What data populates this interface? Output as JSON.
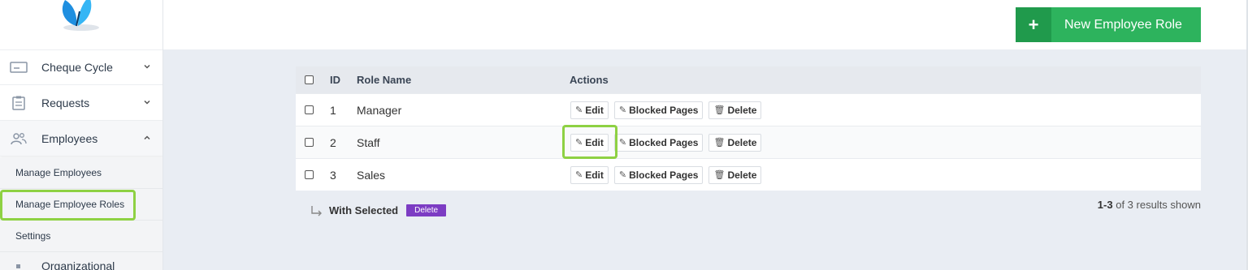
{
  "sidebar": {
    "items": [
      {
        "label": "Cheque Cycle",
        "icon": "card-icon",
        "expanded": false
      },
      {
        "label": "Requests",
        "icon": "clipboard-icon",
        "expanded": false
      },
      {
        "label": "Employees",
        "icon": "users-icon",
        "expanded": true
      }
    ],
    "subitems": [
      {
        "label": "Manage Employees"
      },
      {
        "label": "Manage Employee Roles",
        "highlighted": true
      },
      {
        "label": "Settings"
      }
    ],
    "partial_item": {
      "label": "Organizational"
    }
  },
  "header": {
    "new_button": {
      "label": "New Employee Role",
      "icon": "plus-icon"
    }
  },
  "table": {
    "columns": {
      "id": "ID",
      "name": "Role Name",
      "actions": "Actions"
    },
    "action_labels": {
      "edit": "Edit",
      "blocked": "Blocked Pages",
      "delete": "Delete"
    },
    "rows": [
      {
        "id": "1",
        "name": "Manager"
      },
      {
        "id": "2",
        "name": "Staff"
      },
      {
        "id": "3",
        "name": "Sales"
      }
    ]
  },
  "footer": {
    "with_selected": "With Selected",
    "delete_label": "Delete",
    "results_range": "1-3",
    "results_text": "of 3 results shown"
  },
  "colors": {
    "accent_green": "#2db35d",
    "highlight_green": "#8ed143",
    "delete_purple": "#7c3cc3"
  }
}
